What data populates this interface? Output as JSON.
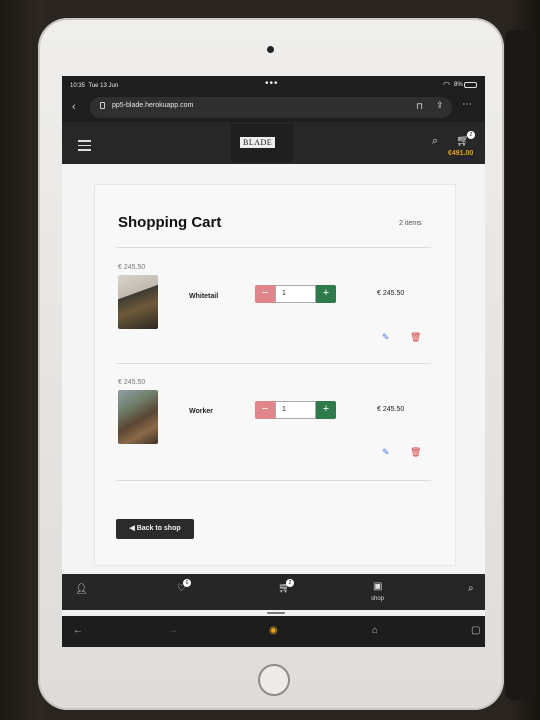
{
  "status": {
    "time": "10:35",
    "date": "Tue 13 Jun",
    "battery": "8%"
  },
  "browser": {
    "url": "pp5-blade.herokuapp.com",
    "back_icon": "chevron-left-icon"
  },
  "site_nav": {
    "logo_text": "BLADE",
    "cart_count": "2",
    "cart_total": "€491.00"
  },
  "cart": {
    "title": "Shopping Cart",
    "item_count": "2 items",
    "items": [
      {
        "name": "Whitetail",
        "unit_price": "€ 245.50",
        "quantity": "1",
        "line_total": "€ 245.50"
      },
      {
        "name": "Worker",
        "unit_price": "€ 245.50",
        "quantity": "1",
        "line_total": "€ 245.50"
      }
    ],
    "back_button": "Back to shop"
  },
  "tabbar": {
    "wishlist_count": "0",
    "cart_count": "2",
    "shop_label": "shop"
  },
  "colors": {
    "accent_total": "#e0a323",
    "minus": "#e0868a",
    "plus": "#2f7a4a",
    "edit": "#4a78d8",
    "delete": "#d23a3a"
  }
}
